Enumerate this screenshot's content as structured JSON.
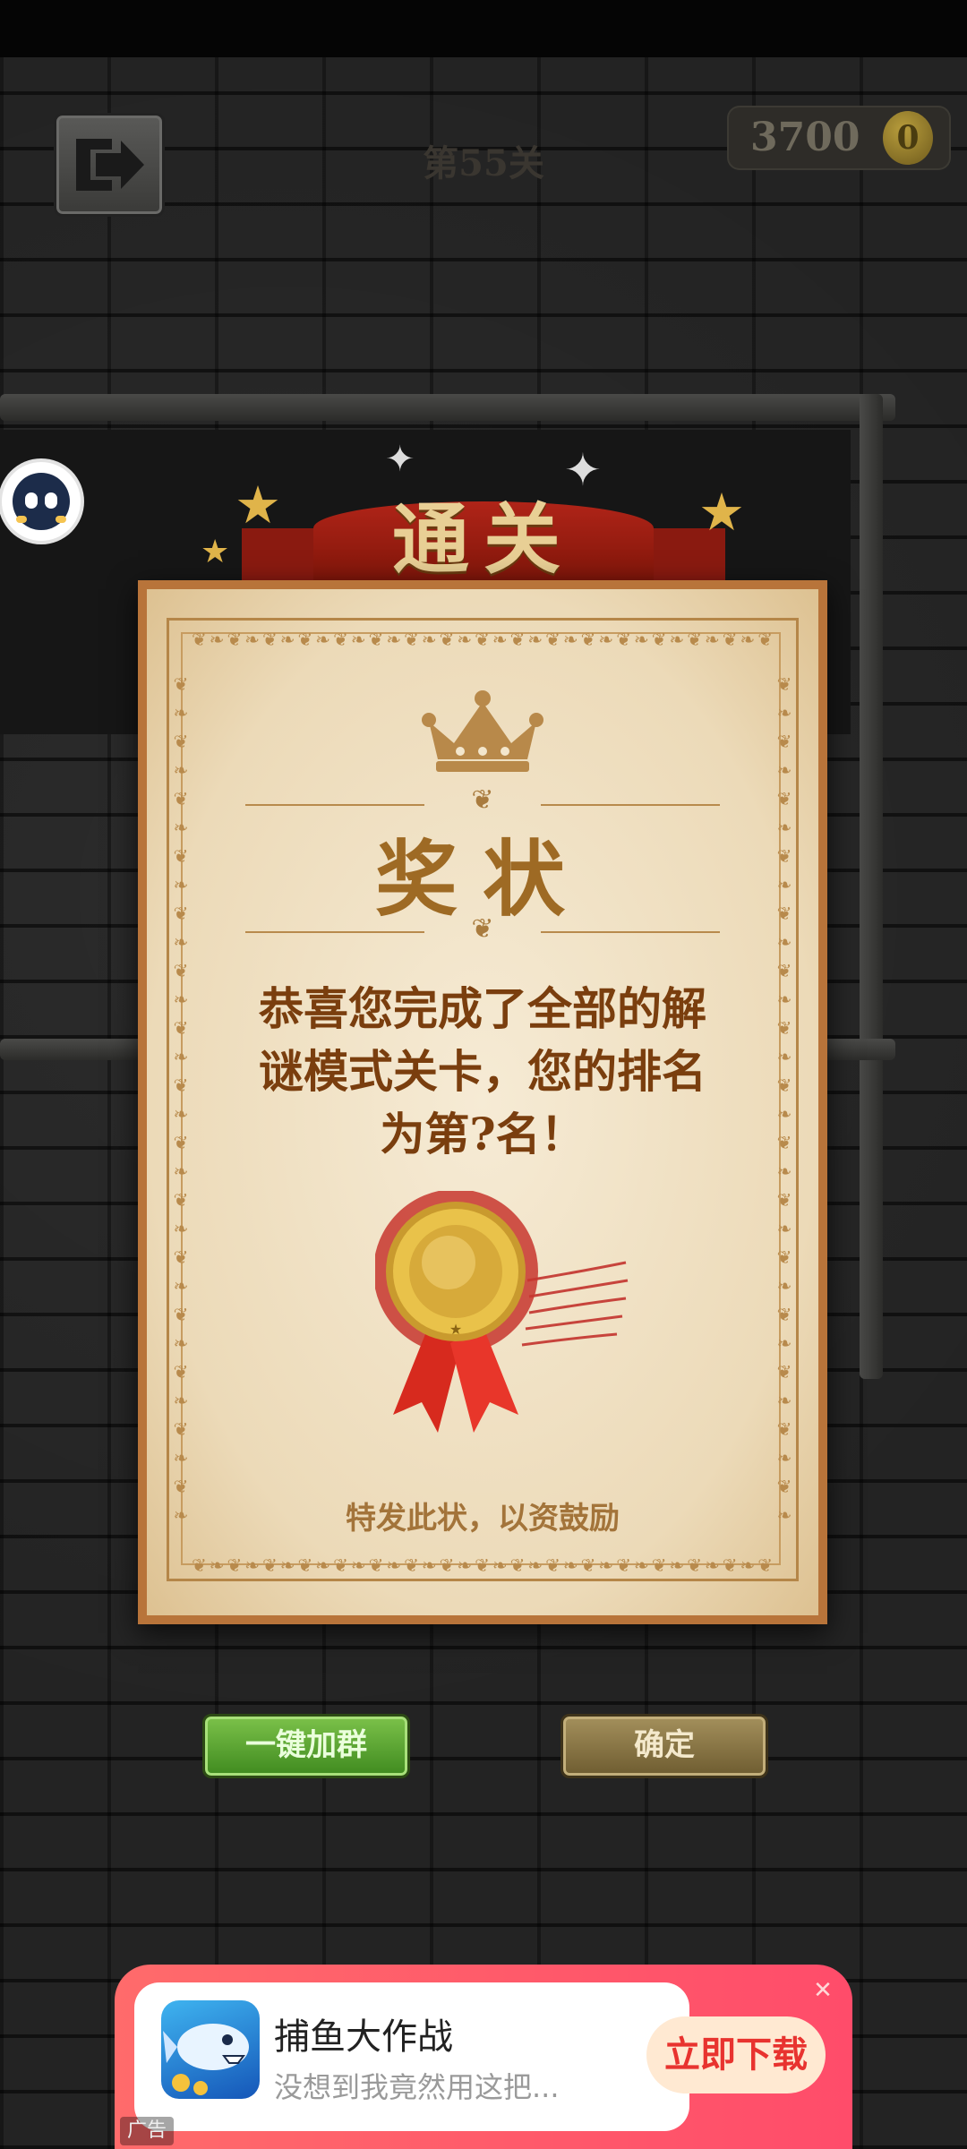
{
  "game": {
    "level_title": "第55关",
    "coins": "3700",
    "coin_symbol": "0"
  },
  "banner": {
    "text": "通关"
  },
  "certificate": {
    "title": "奖状",
    "message_lines": [
      "恭喜您完成了全部的解",
      "谜模式关卡，您的排名",
      "为第?名！"
    ],
    "footer": "特发此状，以资鼓励"
  },
  "buttons": {
    "join_group": "一键加群",
    "confirm": "确定"
  },
  "ad": {
    "app_name": "捕鱼大作战",
    "description": "没想到我竟然用这把...",
    "cta": "立即下载",
    "close": "✕",
    "label": "广告"
  },
  "colors": {
    "certificate_border": "#b8743a",
    "title_gold": "#9e6a24",
    "message_brown": "#7a3e0e",
    "button_green": "#5aa033",
    "button_khaki": "#8a7748",
    "ad_red": "#ff5a6a"
  },
  "icons": {
    "exit": "exit-arrow-icon",
    "coin": "gold-coin-icon",
    "assistant": "assistant-face-icon",
    "crown": "crown-icon",
    "medal": "gold-medal-icon",
    "close": "close-icon"
  }
}
